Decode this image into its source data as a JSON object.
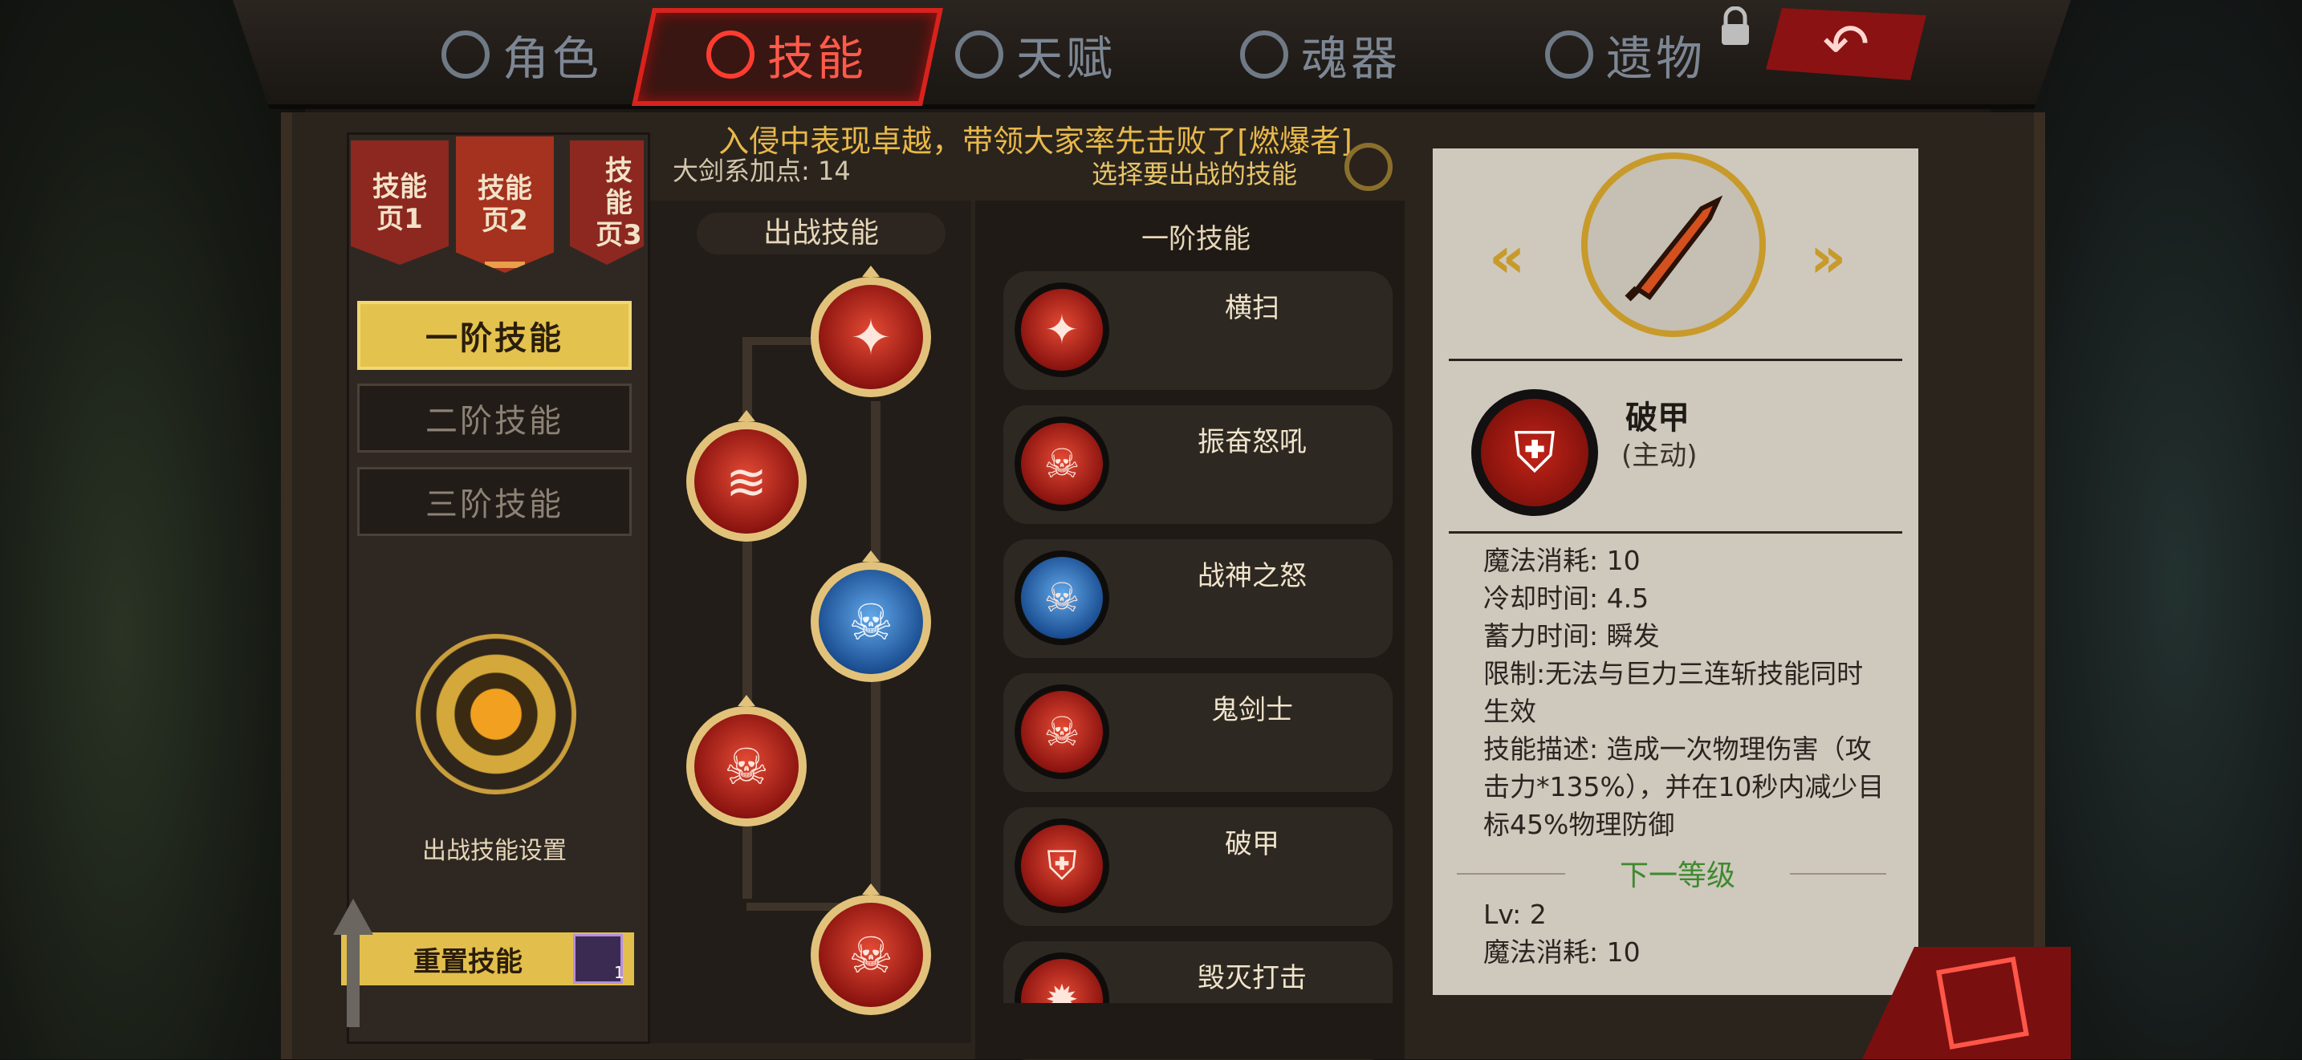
{
  "tabs": [
    {
      "label": "角色",
      "icon": "helmet-icon",
      "active": false
    },
    {
      "label": "技能",
      "icon": "flame-icon",
      "active": true
    },
    {
      "label": "天赋",
      "icon": "crystal-icon",
      "active": false
    },
    {
      "label": "魂器",
      "icon": "soul-icon",
      "active": false
    },
    {
      "label": "遗物",
      "icon": "relic-icon",
      "active": false
    }
  ],
  "skill_pages": [
    {
      "label": "技能\n页1"
    },
    {
      "label": "技能\n页2"
    },
    {
      "label": "技能\n页3"
    }
  ],
  "tiers": [
    "一阶技能",
    "二阶技能",
    "三阶技能"
  ],
  "battle_setting_label": "出战技能设置",
  "reset_label": "重置技能",
  "reset_item_count": "1",
  "notice": "入侵中表现卓越，带领大家率先击败了[燃爆者]",
  "bonus": "大剑系加点: 14",
  "choose_prompt": "选择要出战的技能",
  "battle_title": "出战技能",
  "list_title": "一阶技能",
  "skills": [
    {
      "name": "横扫",
      "icon": "slash-icon",
      "color": "red"
    },
    {
      "name": "振奋怒吼",
      "icon": "roar-icon",
      "color": "red"
    },
    {
      "name": "战神之怒",
      "icon": "wargod-icon",
      "color": "blue"
    },
    {
      "name": "鬼剑士",
      "icon": "ghost-sword-icon",
      "color": "red"
    },
    {
      "name": "破甲",
      "icon": "armor-break-icon",
      "color": "red"
    },
    {
      "name": "毁灭打击",
      "icon": "destroy-icon",
      "color": "red"
    }
  ],
  "detail": {
    "name": "破甲",
    "type": "(主动)",
    "stats": [
      "魔法消耗: 10",
      "冷却时间: 4.5",
      "蓄力时间: 瞬发"
    ],
    "restriction": "限制:无法与巨力三连斩技能同时生效",
    "description": "技能描述: 造成一次物理伤害（攻击力*135%），并在10秒内减少目标45%物理防御",
    "next_level_label": "下一等级",
    "next_stats": [
      "Lv: 2",
      "魔法消耗: 10"
    ]
  }
}
